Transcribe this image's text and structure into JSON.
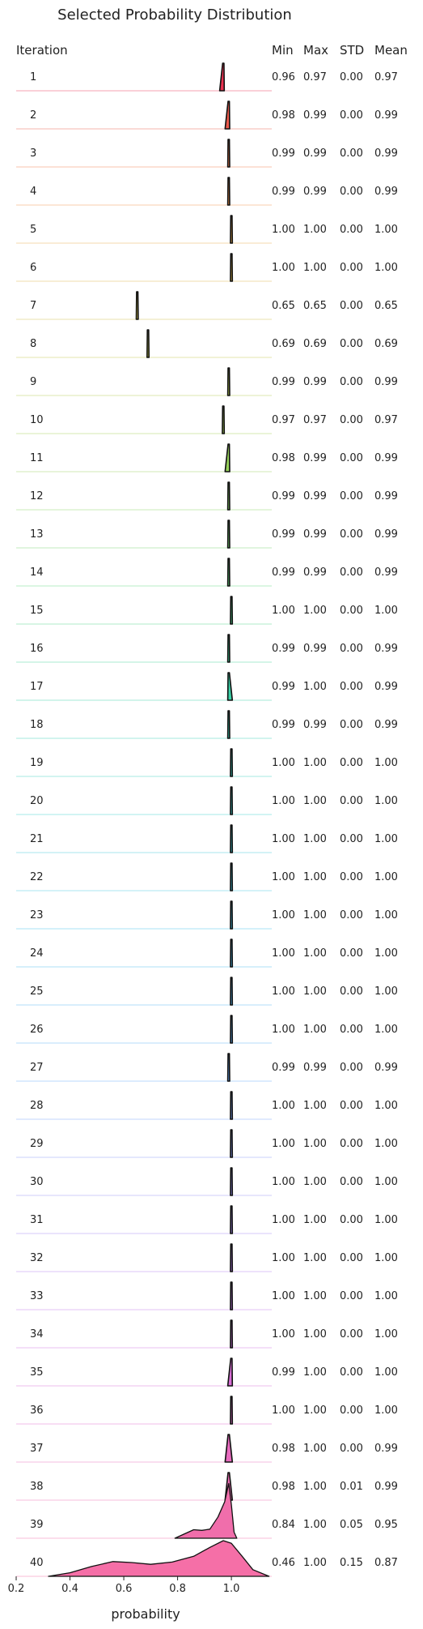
{
  "chart_data": {
    "type": "ridgeline",
    "title": "Selected Probability Distribution",
    "xlabel": "probability",
    "xlim": [
      0.2,
      1.15
    ],
    "xticks": [
      "0.2",
      "0.4",
      "0.6",
      "0.8",
      "1.0"
    ],
    "columns": [
      "Iteration",
      "Min",
      "Max",
      "STD",
      "Mean"
    ],
    "rows": [
      {
        "iteration": "1",
        "min": "0.96",
        "max": "0.97",
        "std": "0.00",
        "mean": "0.97",
        "color": "#e8304f"
      },
      {
        "iteration": "2",
        "min": "0.98",
        "max": "0.99",
        "std": "0.00",
        "mean": "0.99",
        "color": "#ec5a4c"
      },
      {
        "iteration": "3",
        "min": "0.99",
        "max": "0.99",
        "std": "0.00",
        "mean": "0.99",
        "color": "#ef7a4a"
      },
      {
        "iteration": "4",
        "min": "0.99",
        "max": "0.99",
        "std": "0.00",
        "mean": "0.99",
        "color": "#f0934a"
      },
      {
        "iteration": "5",
        "min": "1.00",
        "max": "1.00",
        "std": "0.00",
        "mean": "1.00",
        "color": "#e9a948"
      },
      {
        "iteration": "6",
        "min": "1.00",
        "max": "1.00",
        "std": "0.00",
        "mean": "1.00",
        "color": "#dcb549"
      },
      {
        "iteration": "7",
        "min": "0.65",
        "max": "0.65",
        "std": "0.00",
        "mean": "0.65",
        "color": "#cdbe4a"
      },
      {
        "iteration": "8",
        "min": "0.69",
        "max": "0.69",
        "std": "0.00",
        "mean": "0.69",
        "color": "#c0c54c"
      },
      {
        "iteration": "9",
        "min": "0.99",
        "max": "0.99",
        "std": "0.00",
        "mean": "0.99",
        "color": "#b3c94e"
      },
      {
        "iteration": "10",
        "min": "0.97",
        "max": "0.97",
        "std": "0.00",
        "mean": "0.97",
        "color": "#a5cd52"
      },
      {
        "iteration": "11",
        "min": "0.98",
        "max": "0.99",
        "std": "0.00",
        "mean": "0.99",
        "color": "#96d05a"
      },
      {
        "iteration": "12",
        "min": "0.99",
        "max": "0.99",
        "std": "0.00",
        "mean": "0.99",
        "color": "#86d264"
      },
      {
        "iteration": "13",
        "min": "0.99",
        "max": "0.99",
        "std": "0.00",
        "mean": "0.99",
        "color": "#73d36f"
      },
      {
        "iteration": "14",
        "min": "0.99",
        "max": "0.99",
        "std": "0.00",
        "mean": "0.99",
        "color": "#5fd47c"
      },
      {
        "iteration": "15",
        "min": "1.00",
        "max": "1.00",
        "std": "0.00",
        "mean": "1.00",
        "color": "#4dd38a"
      },
      {
        "iteration": "16",
        "min": "0.99",
        "max": "0.99",
        "std": "0.00",
        "mean": "0.99",
        "color": "#40d299"
      },
      {
        "iteration": "17",
        "min": "0.99",
        "max": "1.00",
        "std": "0.00",
        "mean": "0.99",
        "color": "#39d1a7"
      },
      {
        "iteration": "18",
        "min": "0.99",
        "max": "0.99",
        "std": "0.00",
        "mean": "0.99",
        "color": "#37cfb3"
      },
      {
        "iteration": "19",
        "min": "1.00",
        "max": "1.00",
        "std": "0.00",
        "mean": "1.00",
        "color": "#38cdbf"
      },
      {
        "iteration": "20",
        "min": "1.00",
        "max": "1.00",
        "std": "0.00",
        "mean": "1.00",
        "color": "#3acbca"
      },
      {
        "iteration": "21",
        "min": "1.00",
        "max": "1.00",
        "std": "0.00",
        "mean": "1.00",
        "color": "#3cc8d4"
      },
      {
        "iteration": "22",
        "min": "1.00",
        "max": "1.00",
        "std": "0.00",
        "mean": "1.00",
        "color": "#3fc4dd"
      },
      {
        "iteration": "23",
        "min": "1.00",
        "max": "1.00",
        "std": "0.00",
        "mean": "1.00",
        "color": "#42c0e6"
      },
      {
        "iteration": "24",
        "min": "1.00",
        "max": "1.00",
        "std": "0.00",
        "mean": "1.00",
        "color": "#47bbee"
      },
      {
        "iteration": "25",
        "min": "1.00",
        "max": "1.00",
        "std": "0.00",
        "mean": "1.00",
        "color": "#4fb5f3"
      },
      {
        "iteration": "26",
        "min": "1.00",
        "max": "1.00",
        "std": "0.00",
        "mean": "1.00",
        "color": "#5aaff6"
      },
      {
        "iteration": "27",
        "min": "0.99",
        "max": "0.99",
        "std": "0.00",
        "mean": "0.99",
        "color": "#67a8f8"
      },
      {
        "iteration": "28",
        "min": "1.00",
        "max": "1.00",
        "std": "0.00",
        "mean": "1.00",
        "color": "#76a0f8"
      },
      {
        "iteration": "29",
        "min": "1.00",
        "max": "1.00",
        "std": "0.00",
        "mean": "1.00",
        "color": "#8598f7"
      },
      {
        "iteration": "30",
        "min": "1.00",
        "max": "1.00",
        "std": "0.00",
        "mean": "1.00",
        "color": "#958ff5"
      },
      {
        "iteration": "31",
        "min": "1.00",
        "max": "1.00",
        "std": "0.00",
        "mean": "1.00",
        "color": "#a486f2"
      },
      {
        "iteration": "32",
        "min": "1.00",
        "max": "1.00",
        "std": "0.00",
        "mean": "1.00",
        "color": "#b37eee"
      },
      {
        "iteration": "33",
        "min": "1.00",
        "max": "1.00",
        "std": "0.00",
        "mean": "1.00",
        "color": "#c177e8"
      },
      {
        "iteration": "34",
        "min": "1.00",
        "max": "1.00",
        "std": "0.00",
        "mean": "1.00",
        "color": "#cd71e0"
      },
      {
        "iteration": "35",
        "min": "0.99",
        "max": "1.00",
        "std": "0.00",
        "mean": "1.00",
        "color": "#d86dd6"
      },
      {
        "iteration": "36",
        "min": "1.00",
        "max": "1.00",
        "std": "0.00",
        "mean": "1.00",
        "color": "#e16bcb"
      },
      {
        "iteration": "37",
        "min": "0.98",
        "max": "1.00",
        "std": "0.00",
        "mean": "0.99",
        "color": "#e86bbf"
      },
      {
        "iteration": "38",
        "min": "0.98",
        "max": "1.00",
        "std": "0.01",
        "mean": "0.99",
        "color": "#ed6cb4"
      },
      {
        "iteration": "39",
        "min": "0.84",
        "max": "1.00",
        "std": "0.05",
        "mean": "0.95",
        "color": "#f06eab"
      },
      {
        "iteration": "40",
        "min": "0.46",
        "max": "1.00",
        "std": "0.15",
        "mean": "0.87",
        "color": "#f56fa7"
      }
    ],
    "densities": {
      "39": [
        [
          0.79,
          0.0
        ],
        [
          0.82,
          0.06
        ],
        [
          0.86,
          0.14
        ],
        [
          0.89,
          0.13
        ],
        [
          0.92,
          0.15
        ],
        [
          0.95,
          0.35
        ],
        [
          0.975,
          0.6
        ],
        [
          0.99,
          0.9
        ],
        [
          1.0,
          0.55
        ],
        [
          1.01,
          0.1
        ],
        [
          1.02,
          0.0
        ]
      ],
      "40": [
        [
          0.32,
          0.0
        ],
        [
          0.4,
          0.08
        ],
        [
          0.48,
          0.22
        ],
        [
          0.56,
          0.33
        ],
        [
          0.63,
          0.31
        ],
        [
          0.7,
          0.27
        ],
        [
          0.78,
          0.32
        ],
        [
          0.86,
          0.45
        ],
        [
          0.92,
          0.65
        ],
        [
          0.97,
          0.8
        ],
        [
          1.0,
          0.74
        ],
        [
          1.04,
          0.45
        ],
        [
          1.08,
          0.15
        ],
        [
          1.14,
          0.0
        ]
      ]
    }
  }
}
